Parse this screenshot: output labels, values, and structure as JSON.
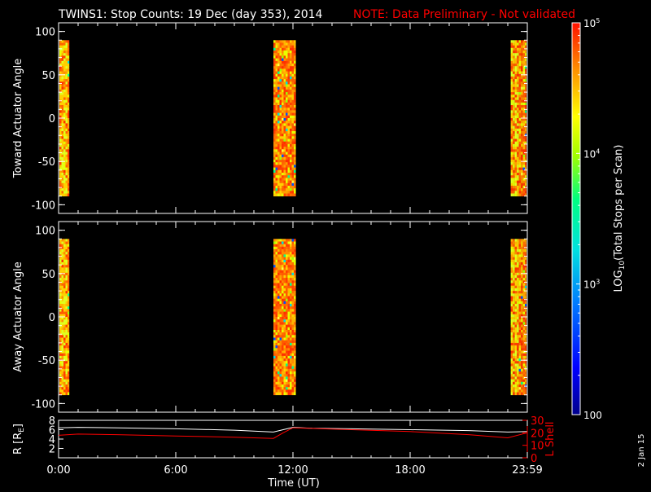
{
  "title": "TWINS1: Stop Counts: 19 Dec (day 353), 2014",
  "note": "NOTE: Data Preliminary - Not validated",
  "date_stamp": "2 Jan 15",
  "chart_data": [
    {
      "type": "heatmap",
      "name": "toward",
      "ylabel": "Toward Actuator Angle",
      "yticks": [
        100,
        50,
        0,
        -50,
        -100
      ],
      "ylim": [
        -110,
        110
      ],
      "angle_range": [
        -90,
        90
      ],
      "xlim_hours": [
        0,
        24
      ],
      "scan_blocks_hours": [
        [
          0.0,
          0.55
        ],
        [
          11.0,
          12.15
        ],
        [
          23.15,
          24.0
        ]
      ]
    },
    {
      "type": "heatmap",
      "name": "away",
      "ylabel": "Away Actuator Angle",
      "yticks": [
        100,
        50,
        0,
        -50,
        -100
      ],
      "ylim": [
        -110,
        110
      ],
      "angle_range": [
        -90,
        90
      ],
      "xlim_hours": [
        0,
        24
      ],
      "scan_blocks_hours": [
        [
          0.0,
          0.55
        ],
        [
          11.0,
          12.15
        ],
        [
          23.15,
          24.0
        ]
      ]
    },
    {
      "type": "line",
      "name": "orbit",
      "ylabel_left": "R [R",
      "ylabel_left_sub": "E",
      "ylabel_left_close": "]",
      "ylabel_right": "L Shell",
      "yticks_left": [
        8,
        6,
        4,
        2
      ],
      "yticks_right": [
        30,
        20,
        10,
        0
      ],
      "ylim_left": [
        0,
        8
      ],
      "ylim_right": [
        0,
        30
      ],
      "xlabel": "Time (UT)",
      "xticks": [
        "0:00",
        "6:00",
        "12:00",
        "18:00",
        "23:59"
      ],
      "xtick_hours": [
        0,
        6,
        12,
        18,
        24
      ],
      "series": [
        {
          "color": "#ffffff",
          "x": [
            0,
            1,
            3,
            6,
            9,
            11,
            11.5,
            12,
            13,
            15,
            18,
            21,
            23,
            24
          ],
          "y": [
            6.4,
            6.5,
            6.4,
            6.2,
            5.9,
            5.5,
            6.0,
            6.5,
            6.3,
            6.2,
            6.0,
            5.8,
            5.5,
            5.6
          ]
        },
        {
          "color": "#ff0000",
          "x": [
            0,
            1,
            3,
            6,
            9,
            11,
            11.5,
            12,
            13,
            15,
            18,
            21,
            23,
            24
          ],
          "y": [
            18.0,
            19.0,
            18.5,
            17.5,
            16.5,
            15.5,
            20.0,
            24.0,
            23.5,
            22.5,
            21.0,
            18.5,
            16.0,
            20.0
          ]
        }
      ]
    }
  ],
  "colorbar": {
    "label_prefix": "LOG",
    "label_sub": "10",
    "label_rest": "(Total Stops per Scan)",
    "ticks": [
      {
        "base": "10",
        "exp": "5",
        "value": 100000
      },
      {
        "base": "10",
        "exp": "4",
        "value": 10000
      },
      {
        "base": "10",
        "exp": "3",
        "value": 1000
      },
      {
        "base": "100",
        "exp": "",
        "value": 100
      }
    ],
    "min": 100,
    "max": 100000
  }
}
